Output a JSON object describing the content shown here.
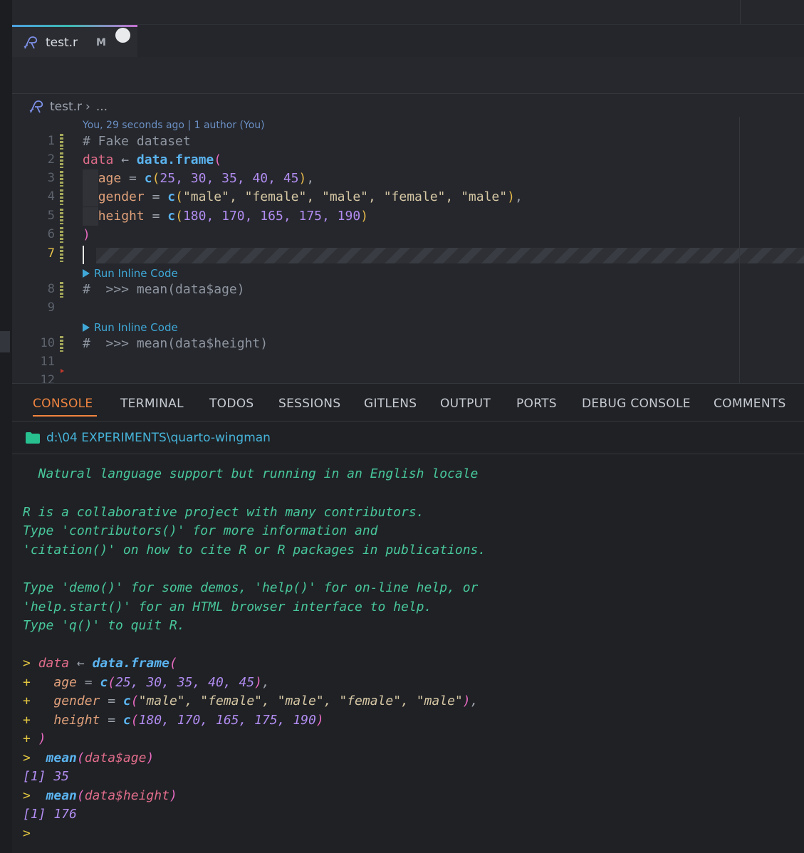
{
  "tab": {
    "title": "test.r",
    "badge": "M"
  },
  "breadcrumb": {
    "file": "test.r",
    "chevron": "›",
    "ellipsis": "..."
  },
  "blame": "You, 29 seconds ago | 1 author (You)",
  "editor_lines": [
    {
      "num": "1"
    },
    {
      "num": "2"
    },
    {
      "num": "3"
    },
    {
      "num": "4"
    },
    {
      "num": "5"
    },
    {
      "num": "6"
    },
    {
      "num": "7"
    },
    {
      "num": "8"
    },
    {
      "num": "9"
    },
    {
      "num": "10"
    },
    {
      "num": "11"
    },
    {
      "num": "12"
    }
  ],
  "code": {
    "l1": "# Fake dataset",
    "l2_var": "data",
    "l2_arrow": "←",
    "l2_fn": "data.frame",
    "l3_var": "age",
    "l3_vals": "25, 30, 35, 40, 45",
    "l4_var": "gender",
    "l4_vals": "\"male\", \"female\", \"male\", \"female\", \"male\"",
    "l5_var": "height",
    "l5_vals": "180, 170, 165, 175, 190",
    "l8": "#  >>> mean(data$age)",
    "l10": "#  >>> mean(data$height)"
  },
  "codelens": {
    "label": "Run Inline Code"
  },
  "panel_tabs": [
    "CONSOLE",
    "TERMINAL",
    "TODOS",
    "SESSIONS",
    "GITLENS",
    "OUTPUT",
    "PORTS",
    "DEBUG CONSOLE",
    "COMMENTS"
  ],
  "path": "d:\\04 EXPERIMENTS\\quarto-wingman",
  "console": {
    "msg1": "  Natural language support but running in an English locale",
    "msg2": "R is a collaborative project with many contributors.",
    "msg3": "Type 'contributors()' for more information and",
    "msg4": "'citation()' on how to cite R or R packages in publications.",
    "msg5": "Type 'demo()' for some demos, 'help()' for on-line help, or",
    "msg6": "'help.start()' for an HTML browser interface to help.",
    "msg7": "Type 'q()' to quit R.",
    "prompt": ">",
    "cont": "+",
    "out1": "[1] 35",
    "out2": "[1] 176"
  },
  "colors": {
    "accent": "#f08540",
    "path": "#46b3d8",
    "console_text": "#48c79a"
  }
}
